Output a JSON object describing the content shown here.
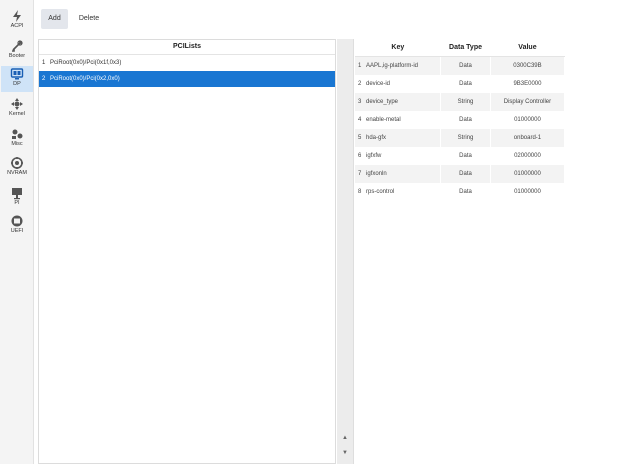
{
  "sidebar": {
    "items": [
      {
        "label": "ACPI",
        "icon": "lightning-icon",
        "active": false
      },
      {
        "label": "Booter",
        "icon": "tools-icon",
        "active": false
      },
      {
        "label": "DP",
        "icon": "display-icon",
        "active": true
      },
      {
        "label": "Kernel",
        "icon": "kernel-icon",
        "active": false
      },
      {
        "label": "Misc",
        "icon": "misc-icon",
        "active": false
      },
      {
        "label": "NVRAM",
        "icon": "nvram-icon",
        "active": false
      },
      {
        "label": "PI",
        "icon": "platforminfo-icon",
        "active": false
      },
      {
        "label": "UEFI",
        "icon": "uefi-icon",
        "active": false
      }
    ]
  },
  "toolbar": {
    "add_label": "Add",
    "delete_label": "Delete"
  },
  "pci_list": {
    "header": "PCILists",
    "rows": [
      {
        "index": "1",
        "path": "PciRoot(0x0)/Pci(0x1f,0x3)",
        "selected": false
      },
      {
        "index": "2",
        "path": "PciRoot(0x0)/Pci(0x2,0x0)",
        "selected": true
      }
    ]
  },
  "properties": {
    "headers": {
      "key": "Key",
      "type": "Data Type",
      "value": "Value"
    },
    "rows": [
      {
        "index": "1",
        "key": "AAPL,ig-platform-id",
        "type": "Data",
        "value": "0300C39B"
      },
      {
        "index": "2",
        "key": "device-id",
        "type": "Data",
        "value": "9B3E0000"
      },
      {
        "index": "3",
        "key": "device_type",
        "type": "String",
        "value": "Display Controller"
      },
      {
        "index": "4",
        "key": "enable-metal",
        "type": "Data",
        "value": "01000000"
      },
      {
        "index": "5",
        "key": "hda-gfx",
        "type": "String",
        "value": "onboard-1"
      },
      {
        "index": "6",
        "key": "igfxfw",
        "type": "Data",
        "value": "02000000"
      },
      {
        "index": "7",
        "key": "igfxonln",
        "type": "Data",
        "value": "01000000"
      },
      {
        "index": "8",
        "key": "rps-control",
        "type": "Data",
        "value": "01000000"
      }
    ]
  },
  "scroll": {
    "up_arrow": "▲",
    "down_arrow": "▼"
  },
  "colors": {
    "accent": "#1976d2",
    "selected_sidebar": "#cfe3f7"
  }
}
